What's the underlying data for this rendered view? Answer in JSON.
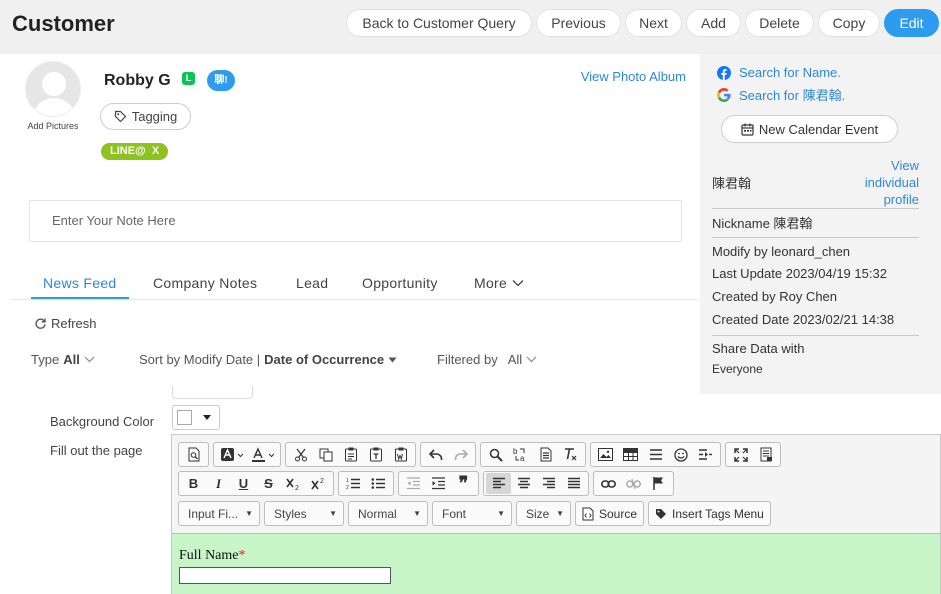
{
  "header": {
    "title": "Customer",
    "buttons": {
      "back": "Back to Customer Query",
      "previous": "Previous",
      "next": "Next",
      "add": "Add",
      "delete": "Delete",
      "copy": "Copy",
      "edit": "Edit"
    }
  },
  "profile": {
    "add_pictures": "Add Pictures",
    "name": "Robby G",
    "line_icon_text": "L",
    "chat_badge": "聊!",
    "view_photo_album": "View Photo Album",
    "tagging_label": "Tagging",
    "line_badge": "LINE@  X",
    "note_placeholder": "Enter Your Note Here"
  },
  "tabs": {
    "items": [
      "News Feed",
      "Company Notes",
      "Lead",
      "Opportunity",
      "More"
    ],
    "active": "News Feed"
  },
  "feed": {
    "refresh": "Refresh",
    "type_label": "Type",
    "type_value": "All",
    "sort_label": "Sort by Modify Date |",
    "sort_value": "Date of Occurrence",
    "filtered_label": "Filtered by",
    "filtered_value": "All"
  },
  "right_panel": {
    "search_name": "Search for Name.",
    "search_chinese": "Search for 陳君翰.",
    "new_calendar_event": "New Calendar Event",
    "chinese_name": "陳君翰",
    "view_profile": "View individual profile",
    "nickname": "Nickname 陳君翰",
    "modify_by": "Modify by leonard_chen",
    "last_update": "Last Update 2023/04/19 15:32",
    "created_by": "Created by Roy Chen",
    "created_date": "Created Date 2023/02/21 14:38",
    "share_data_label": "Share Data with",
    "share_data_value": "Everyone"
  },
  "form": {
    "background_color_label": "Background Color",
    "fill_page_label": "Fill out the page",
    "editor": {
      "combos": {
        "input_field": "Input Fi...",
        "styles": "Styles",
        "format": "Normal",
        "font": "Font",
        "size": "Size"
      },
      "source": "Source",
      "insert_tags_menu": "Insert Tags Menu",
      "content_label": "Full Name",
      "required_mark": "*"
    }
  },
  "colors": {
    "accent": "#2d9bef",
    "link": "#2d87d9",
    "line_green": "#06c755",
    "line_badge": "#8dc21f",
    "editor_content_bg": "#c8f5c8",
    "required": "#e02020"
  }
}
